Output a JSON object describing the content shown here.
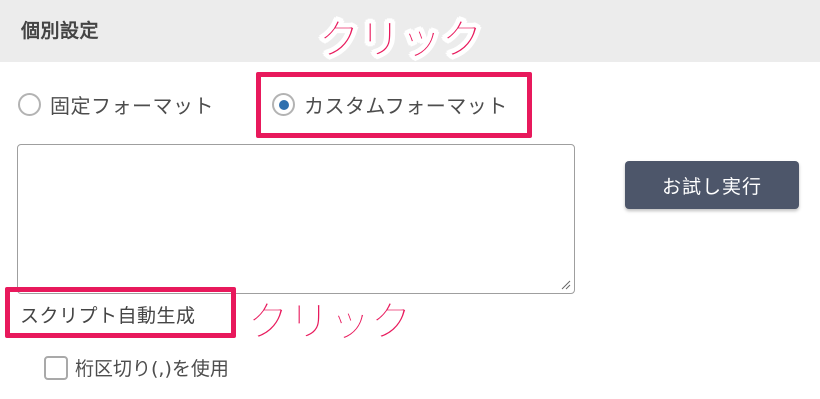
{
  "section": {
    "title": "個別設定"
  },
  "format_options": {
    "fixed": {
      "label": "固定フォーマット",
      "selected": false
    },
    "custom": {
      "label": "カスタムフォーマット",
      "selected": true
    }
  },
  "format_textarea": {
    "value": ""
  },
  "buttons": {
    "try_run": "お試し実行"
  },
  "script_generation": {
    "label": "スクリプト自動生成"
  },
  "options": {
    "thousands_separator": {
      "label": "桁区切り(,)を使用",
      "checked": false
    }
  },
  "annotations": {
    "click_top": "クリック",
    "click_bottom": "クリック",
    "accent_color": "#e8195c"
  },
  "colors": {
    "header_bg": "#ececec",
    "button_bg": "#4d566a",
    "radio_selected": "#2e6fae"
  }
}
